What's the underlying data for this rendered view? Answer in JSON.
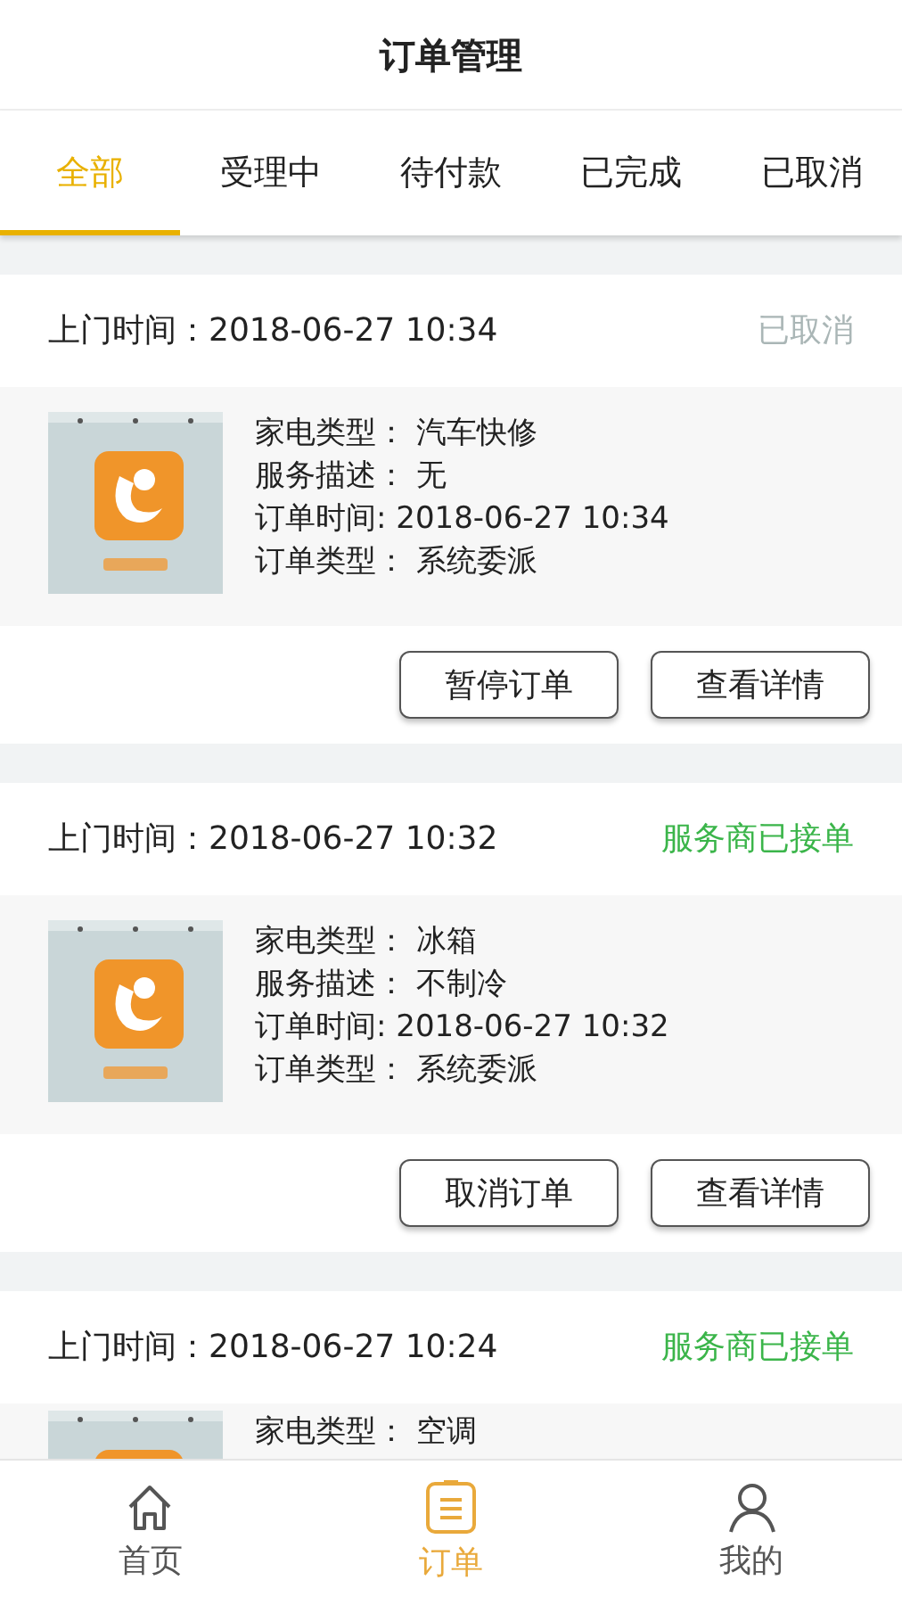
{
  "title": "订单管理",
  "tabs": [
    {
      "label": "全部",
      "selected": true
    },
    {
      "label": "受理中",
      "selected": false
    },
    {
      "label": "待付款",
      "selected": false
    },
    {
      "label": "已完成",
      "selected": false
    },
    {
      "label": "已取消",
      "selected": false
    }
  ],
  "orders": [
    {
      "visit_label": "上门时间：",
      "visit_time": "2018-06-27 10:34",
      "status": "已取消",
      "color": "#aab6b6",
      "details": [
        {
          "label": "家电类型：",
          "value": "汽车快修"
        },
        {
          "label": "服务描述：",
          "value": "无"
        },
        {
          "label": "订单时间:",
          "value": "2018-06-27 10:34"
        },
        {
          "label": "订单类型：",
          "value": "系统委派"
        }
      ],
      "buttons": [
        "暂停订单",
        "查看详情"
      ]
    },
    {
      "visit_label": "上门时间：",
      "visit_time": "2018-06-27 10:32",
      "status": "服务商已接单",
      "color": "#3bb54a",
      "details": [
        {
          "label": "家电类型：",
          "value": "冰箱"
        },
        {
          "label": "服务描述：",
          "value": "不制冷"
        },
        {
          "label": "订单时间:",
          "value": "2018-06-27 10:32"
        },
        {
          "label": "订单类型：",
          "value": "系统委派"
        }
      ],
      "buttons": [
        "取消订单",
        "查看详情"
      ]
    },
    {
      "visit_label": "上门时间：",
      "visit_time": "2018-06-27 10:24",
      "status": "服务商已接单",
      "color": "#3bb54a",
      "details": [
        {
          "label": "家电类型：",
          "value": "空调"
        }
      ]
    }
  ],
  "nav": [
    {
      "label": "首页",
      "kind": "home",
      "selected": false
    },
    {
      "label": "订单",
      "kind": "orders",
      "selected": true
    },
    {
      "label": "我的",
      "kind": "profile",
      "selected": false
    }
  ]
}
